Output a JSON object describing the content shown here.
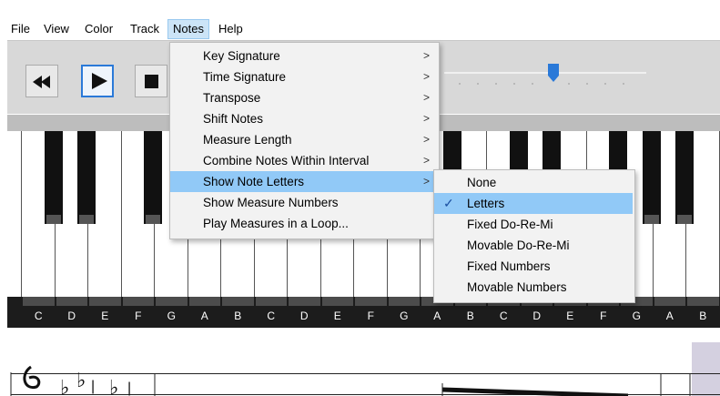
{
  "menubar": {
    "items": [
      "File",
      "View",
      "Color",
      "Track",
      "Notes",
      "Help"
    ]
  },
  "toolbar": {
    "buttons": [
      {
        "name": "rewind-button",
        "icon": "rewind-icon"
      },
      {
        "name": "play-button",
        "icon": "play-icon"
      },
      {
        "name": "stop-button",
        "icon": "stop-icon"
      }
    ],
    "slider_level": 0.52,
    "accent_color": "#2a79d8"
  },
  "notes_menu": {
    "items": [
      {
        "label": "Key Signature",
        "submenu": true
      },
      {
        "label": "Time Signature",
        "submenu": true
      },
      {
        "label": "Transpose",
        "submenu": true
      },
      {
        "label": "Shift Notes",
        "submenu": true
      },
      {
        "label": "Measure Length",
        "submenu": true
      },
      {
        "label": "Combine Notes Within Interval",
        "submenu": true
      },
      {
        "label": "Show Note Letters",
        "submenu": true,
        "highlighted": true
      },
      {
        "label": "Show Measure Numbers",
        "submenu": false
      },
      {
        "label": "Play Measures in a Loop...",
        "submenu": false
      }
    ],
    "arrow": ">"
  },
  "note_letters_submenu": {
    "items": [
      {
        "label": "None",
        "checked": false
      },
      {
        "label": "Letters",
        "checked": true,
        "highlighted": true
      },
      {
        "label": "Fixed Do-Re-Mi",
        "checked": false
      },
      {
        "label": "Movable Do-Re-Mi",
        "checked": false
      },
      {
        "label": "Fixed Numbers",
        "checked": false
      },
      {
        "label": "Movable Numbers",
        "checked": false
      }
    ],
    "check_glyph": "✓"
  },
  "piano": {
    "note_letters": [
      "C",
      "D",
      "E",
      "F",
      "G",
      "A",
      "B",
      "C",
      "D",
      "E",
      "F",
      "G",
      "A",
      "B",
      "C",
      "D",
      "E",
      "F",
      "G",
      "A",
      "B"
    ]
  },
  "colors": {
    "menu_highlight": "#91c9f7",
    "menubar_active": "#cce4f7",
    "piano_background": "#1c1c1c"
  }
}
